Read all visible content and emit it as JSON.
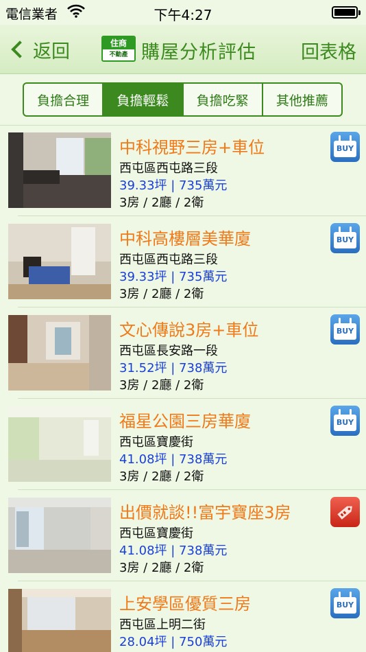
{
  "status_bar": {
    "carrier": "電信業者",
    "time": "下午4:27"
  },
  "nav": {
    "back_label": "返回",
    "logo_top": "住商",
    "logo_bottom": "不動產",
    "title": "購屋分析評估",
    "right_label": "回表格"
  },
  "segments": [
    {
      "label": "負擔合理",
      "active": false
    },
    {
      "label": "負擔輕鬆",
      "active": true
    },
    {
      "label": "負擔吃緊",
      "active": false
    },
    {
      "label": "其他推薦",
      "active": false
    }
  ],
  "listings": [
    {
      "title": "中科視野三房+車位",
      "district": "西屯區西屯路三段",
      "price": "39.33坪 | 735萬元",
      "rooms": "3房 / 2廳 / 2衛",
      "badge": "BUY",
      "badge_icon": "buy-icon"
    },
    {
      "title": "中科高樓層美華廈",
      "district": "西屯區西屯路三段",
      "price": "39.33坪 | 735萬元",
      "rooms": "3房 / 2廳 / 2衛",
      "badge": "BUY",
      "badge_icon": "buy-icon"
    },
    {
      "title": "文心傳說3房+車位",
      "district": "西屯區長安路一段",
      "price": "31.52坪 | 738萬元",
      "rooms": "3房 / 2廳 / 2衛",
      "badge": "BUY",
      "badge_icon": "buy-icon"
    },
    {
      "title": "福星公園三房華廈",
      "district": "西屯區寶慶街",
      "price": "41.08坪 | 738萬元",
      "rooms": "3房 / 2廳 / 2衛",
      "badge": "BUY",
      "badge_icon": "buy-icon"
    },
    {
      "title": "出價就談!!富宇寶座3房",
      "district": "西屯區寶慶街",
      "price": "41.08坪 | 738萬元",
      "rooms": "3房 / 2廳 / 2衛",
      "badge": "",
      "badge_icon": "price-tag-icon"
    },
    {
      "title": "上安學區優質三房",
      "district": "西屯區上明二街",
      "price": "28.04坪 | 750萬元",
      "rooms": "",
      "badge": "BUY",
      "badge_icon": "buy-icon"
    }
  ],
  "colors": {
    "accent_green": "#3c8a1f",
    "title_orange": "#f07a1a",
    "price_blue": "#1a3fd8",
    "background": "#eef8e4"
  }
}
